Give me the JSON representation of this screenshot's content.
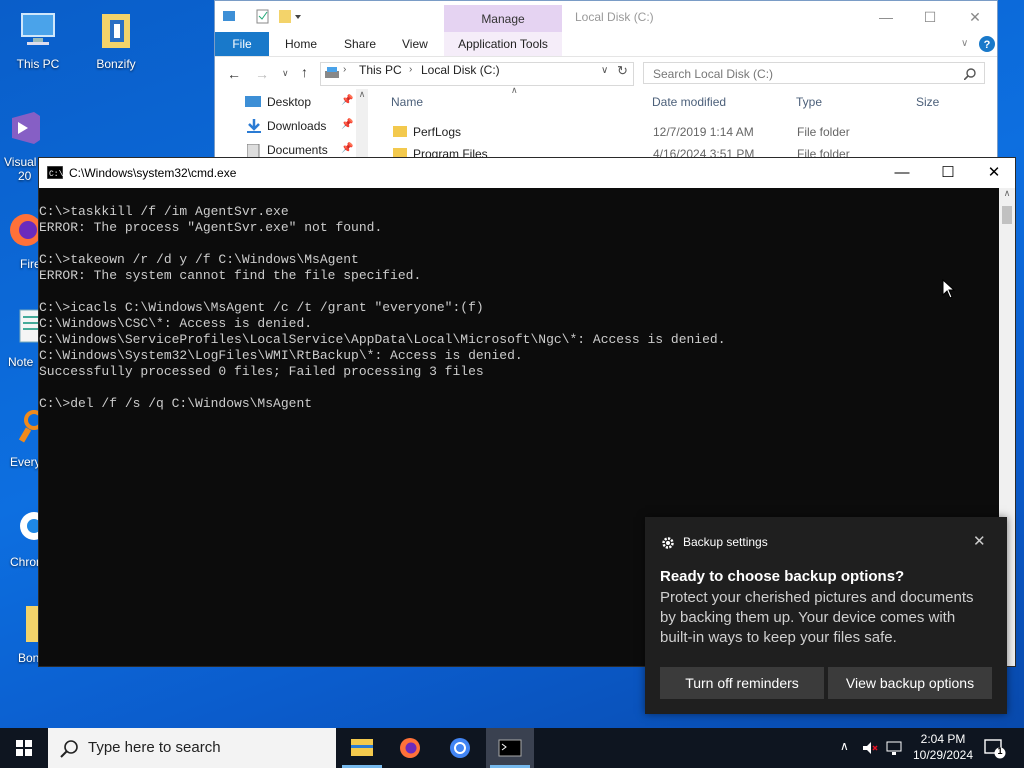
{
  "desktop": {
    "icons": [
      {
        "label": "This PC"
      },
      {
        "label": "Bonzify"
      },
      {
        "label": "Visual"
      },
      {
        "label": "Fire"
      },
      {
        "label": "Note"
      },
      {
        "label": "Every"
      },
      {
        "label": "Chrom"
      },
      {
        "label": "Bon"
      }
    ],
    "icon_extra": [
      "20"
    ]
  },
  "explorer": {
    "manage_tab": "Manage",
    "window_title": "Local Disk (C:)",
    "tabs": [
      "File",
      "Home",
      "Share",
      "View",
      "Application Tools"
    ],
    "breadcrumb": [
      "This PC",
      "Local Disk (C:)"
    ],
    "search_placeholder": "Search Local Disk (C:)",
    "nav": [
      "Desktop",
      "Downloads",
      "Documents"
    ],
    "columns": [
      "Name",
      "Date modified",
      "Type",
      "Size"
    ],
    "rows": [
      {
        "name": "PerfLogs",
        "date": "12/7/2019 1:14 AM",
        "type": "File folder"
      },
      {
        "name": "Program Files",
        "date": "4/16/2024 3:51 PM",
        "type": "File folder"
      }
    ]
  },
  "cmd": {
    "title": "C:\\Windows\\system32\\cmd.exe",
    "lines": [
      "C:\\>taskkill /f /im AgentSvr.exe",
      "ERROR: The process \"AgentSvr.exe\" not found.",
      "",
      "C:\\>takeown /r /d y /f C:\\Windows\\MsAgent",
      "ERROR: The system cannot find the file specified.",
      "",
      "C:\\>icacls C:\\Windows\\MsAgent /c /t /grant \"everyone\":(f)",
      "C:\\Windows\\CSC\\*: Access is denied.",
      "C:\\Windows\\ServiceProfiles\\LocalService\\AppData\\Local\\Microsoft\\Ngc\\*: Access is denied.",
      "C:\\Windows\\System32\\LogFiles\\WMI\\RtBackup\\*: Access is denied.",
      "Successfully processed 0 files; Failed processing 3 files",
      "",
      "C:\\>del /f /s /q C:\\Windows\\MsAgent"
    ]
  },
  "toast": {
    "app_name": "Backup settings",
    "heading": "Ready to choose backup options?",
    "body": "Protect your cherished pictures and documents by backing them up. Your device comes with built-in ways to keep your files safe.",
    "button_left": "Turn off reminders",
    "button_right": "View backup options"
  },
  "taskbar": {
    "search_placeholder": "Type here to search",
    "time": "2:04 PM",
    "date": "10/29/2024",
    "notification_count": "1"
  }
}
